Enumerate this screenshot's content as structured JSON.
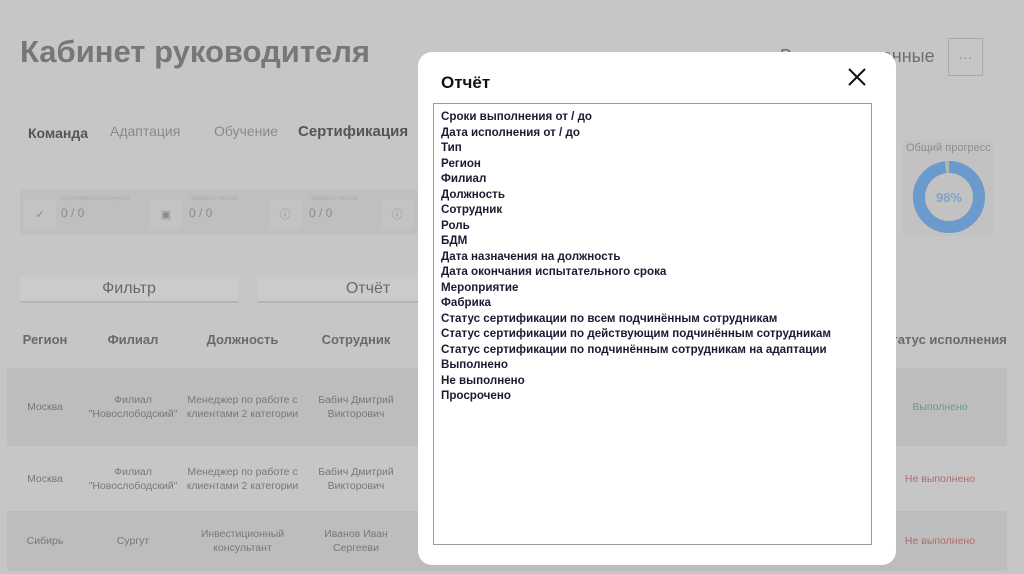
{
  "header": {
    "title": "Кабинет руководителя",
    "export_label": "Выгрузить данные",
    "more_label": "···"
  },
  "tabs": [
    "Команда",
    "Адаптация",
    "Обучение",
    "Сертификация"
  ],
  "stats": [
    {
      "label": "Сертификатов получено",
      "value": "0 / 0"
    },
    {
      "label": "Пройдено тестов",
      "value": "0 / 0"
    },
    {
      "label": "Пройдено кейсов",
      "value": "0 / 0"
    }
  ],
  "progress": {
    "label": "Общий прогресс",
    "value_text": "98%",
    "value": 98,
    "color": "#6a9bcc"
  },
  "buttons": {
    "filter": "Фильтр",
    "report": "Отчёт"
  },
  "table": {
    "headers": [
      "Регион",
      "Филиал",
      "Должность",
      "Сотрудник",
      "Статус исполнения"
    ],
    "rows": [
      {
        "region": "Москва",
        "branch": "Филиал \"Новослободский\"",
        "position": "Менеджер по работе с клиентами 2 категории",
        "employee": "Бабич Дмитрий Викторович",
        "status": "Выполнено"
      },
      {
        "region": "Москва",
        "branch": "Филиал \"Новослободский\"",
        "position": "Менеджер по работе с клиентами 2 категории",
        "employee": "Бабич Дмитрий Викторович",
        "status": "Не выполнено"
      },
      {
        "region": "Сибирь",
        "branch": "Сургут",
        "position": "Инвестиционный консультант",
        "employee": "Иванов Иван Сергееви",
        "status": "Не выполнено"
      }
    ]
  },
  "modal": {
    "title": "Отчёт",
    "items": [
      "Сроки выполнения от / до",
      "Дата исполнения от / до",
      "Тип",
      "Регион",
      "Филиал",
      "Должность",
      "Сотрудник",
      "Роль",
      "БДМ",
      "Дата назначения на должность",
      "Дата окончания испытательного срока",
      "Мероприятие",
      "Фабрика",
      "Статус сертификации по всем подчинённым сотрудникам",
      "Статус сертификации по действующим подчинённым сотрудникам",
      "Статус сертификации по подчинённым сотрудникам на адаптации",
      "Выполнено",
      "Не выполнено",
      "Просрочено"
    ]
  }
}
